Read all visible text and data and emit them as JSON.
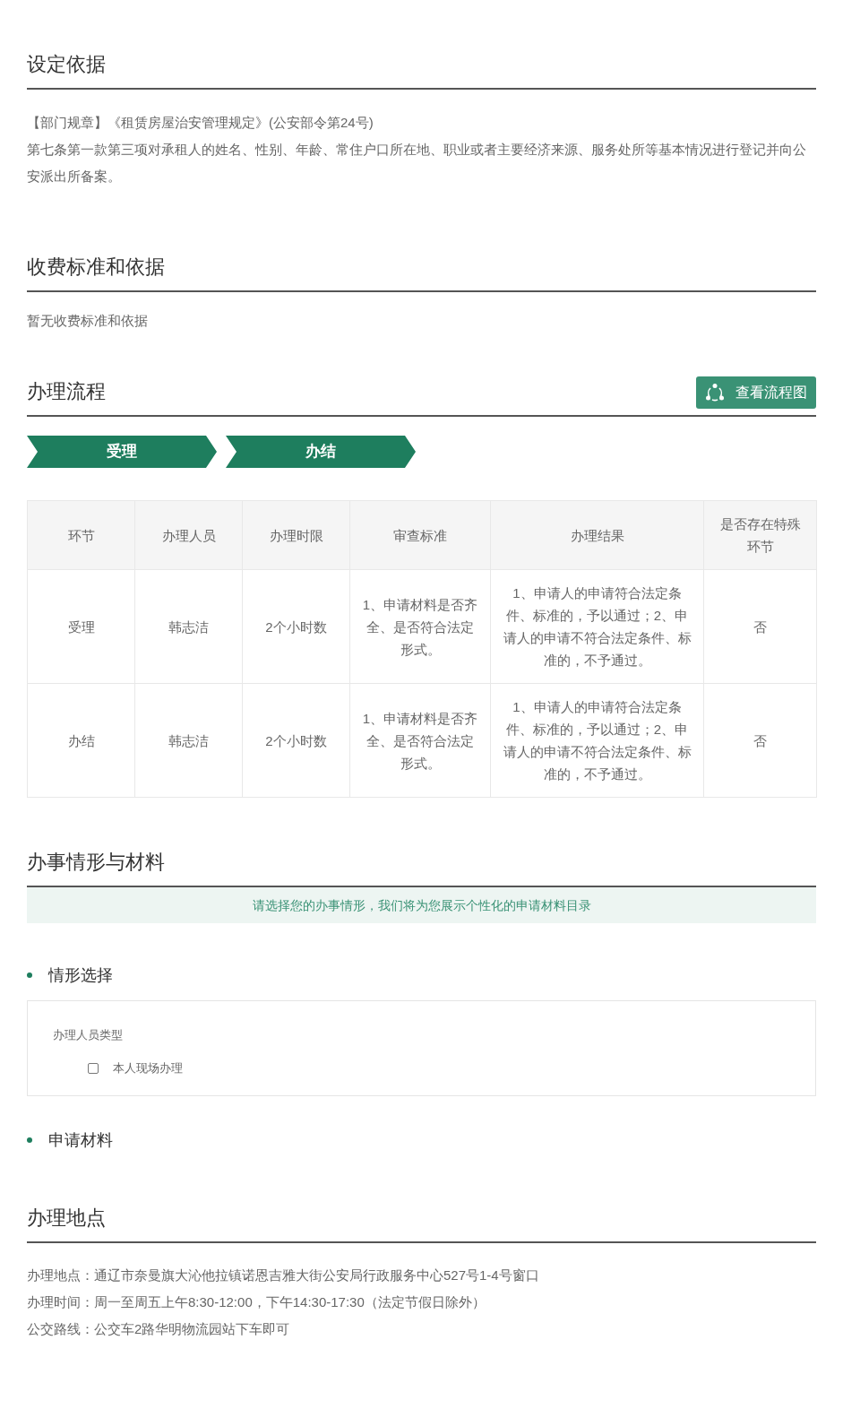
{
  "basis": {
    "title": "设定依据",
    "lines": [
      "【部门规章】《租赁房屋治安管理规定》(公安部令第24号)",
      "第七条第一款第三项对承租人的姓名、性别、年龄、常住户口所在地、职业或者主要经济来源、服务处所等基本情况进行登记并向公安派出所备案。"
    ]
  },
  "fees": {
    "title": "收费标准和依据",
    "text": "暂无收费标准和依据"
  },
  "process": {
    "title": "办理流程",
    "flow_button": "查看流程图",
    "steps": [
      "受理",
      "办结"
    ],
    "table": {
      "columns": [
        "环节",
        "办理人员",
        "办理时限",
        "审查标准",
        "办理结果",
        "是否存在特殊环节"
      ],
      "rows": [
        [
          "受理",
          "韩志洁",
          "2个小时数",
          "1、申请材料是否齐全、是否符合法定形式。",
          "1、申请人的申请符合法定条件、标准的，予以通过；2、申请人的申请不符合法定条件、标准的，不予通过。",
          "否"
        ],
        [
          "办结",
          "韩志洁",
          "2个小时数",
          "1、申请材料是否齐全、是否符合法定形式。",
          "1、申请人的申请符合法定条件、标准的，予以通过；2、申请人的申请不符合法定条件、标准的，不予通过。",
          "否"
        ]
      ]
    }
  },
  "materials": {
    "title": "办事情形与材料",
    "notice": "请选择您的办事情形，我们将为您展示个性化的申请材料目录",
    "situation": {
      "title": "情形选择",
      "group_label": "办理人员类型",
      "options": [
        {
          "label": "本人现场办理",
          "checked": false
        }
      ]
    },
    "materials_title": "申请材料"
  },
  "location": {
    "title": "办理地点",
    "lines": [
      "办理地点：通辽市奈曼旗大沁他拉镇诺恩吉雅大街公安局行政服务中心527号1-4号窗口",
      "办理时间：周一至周五上午8:30-12:00，下午14:30-17:30（法定节假日除外）",
      "公交路线：公交车2路华明物流园站下车即可"
    ]
  }
}
